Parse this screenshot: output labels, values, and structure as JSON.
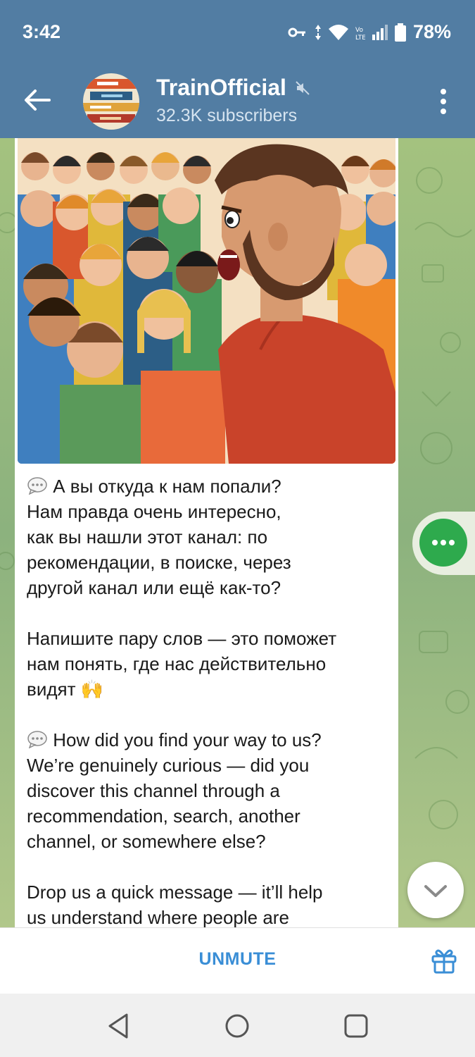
{
  "status_bar": {
    "time": "3:42",
    "battery": "78%",
    "icons": [
      "vpn-key-icon",
      "data-arrows-icon",
      "wifi-icon",
      "volte-icon",
      "signal-icon",
      "battery-icon"
    ]
  },
  "header": {
    "title": "TrainOfficial",
    "subtitle": "32.3K subscribers",
    "muted": true
  },
  "message": {
    "paragraph_ru_1": "А вы откуда к нам попали?\nНам правда очень интересно,\nкак вы нашли этот канал: по\nрекомендации, в поиске, через\nдругой канал или ещё как-то?",
    "paragraph_ru_2": "Напишите пару слов — это поможет\nнам понять, где нас действительно\nвидят",
    "paragraph_en_1": "How did you find your way to us?\nWe’re genuinely curious — did you\ndiscover this channel through a\nrecommendation, search, another\nchannel, or somewhere else?",
    "paragraph_en_2": "Drop us a quick message — it’ll help\nus understand where people are",
    "emoji_hands": "🙌"
  },
  "bottom_bar": {
    "unmute_label": "UNMUTE"
  },
  "colors": {
    "header_bg": "#527da3",
    "accent_blue": "#3a8ed6",
    "green_fab": "#2eaa4d"
  }
}
